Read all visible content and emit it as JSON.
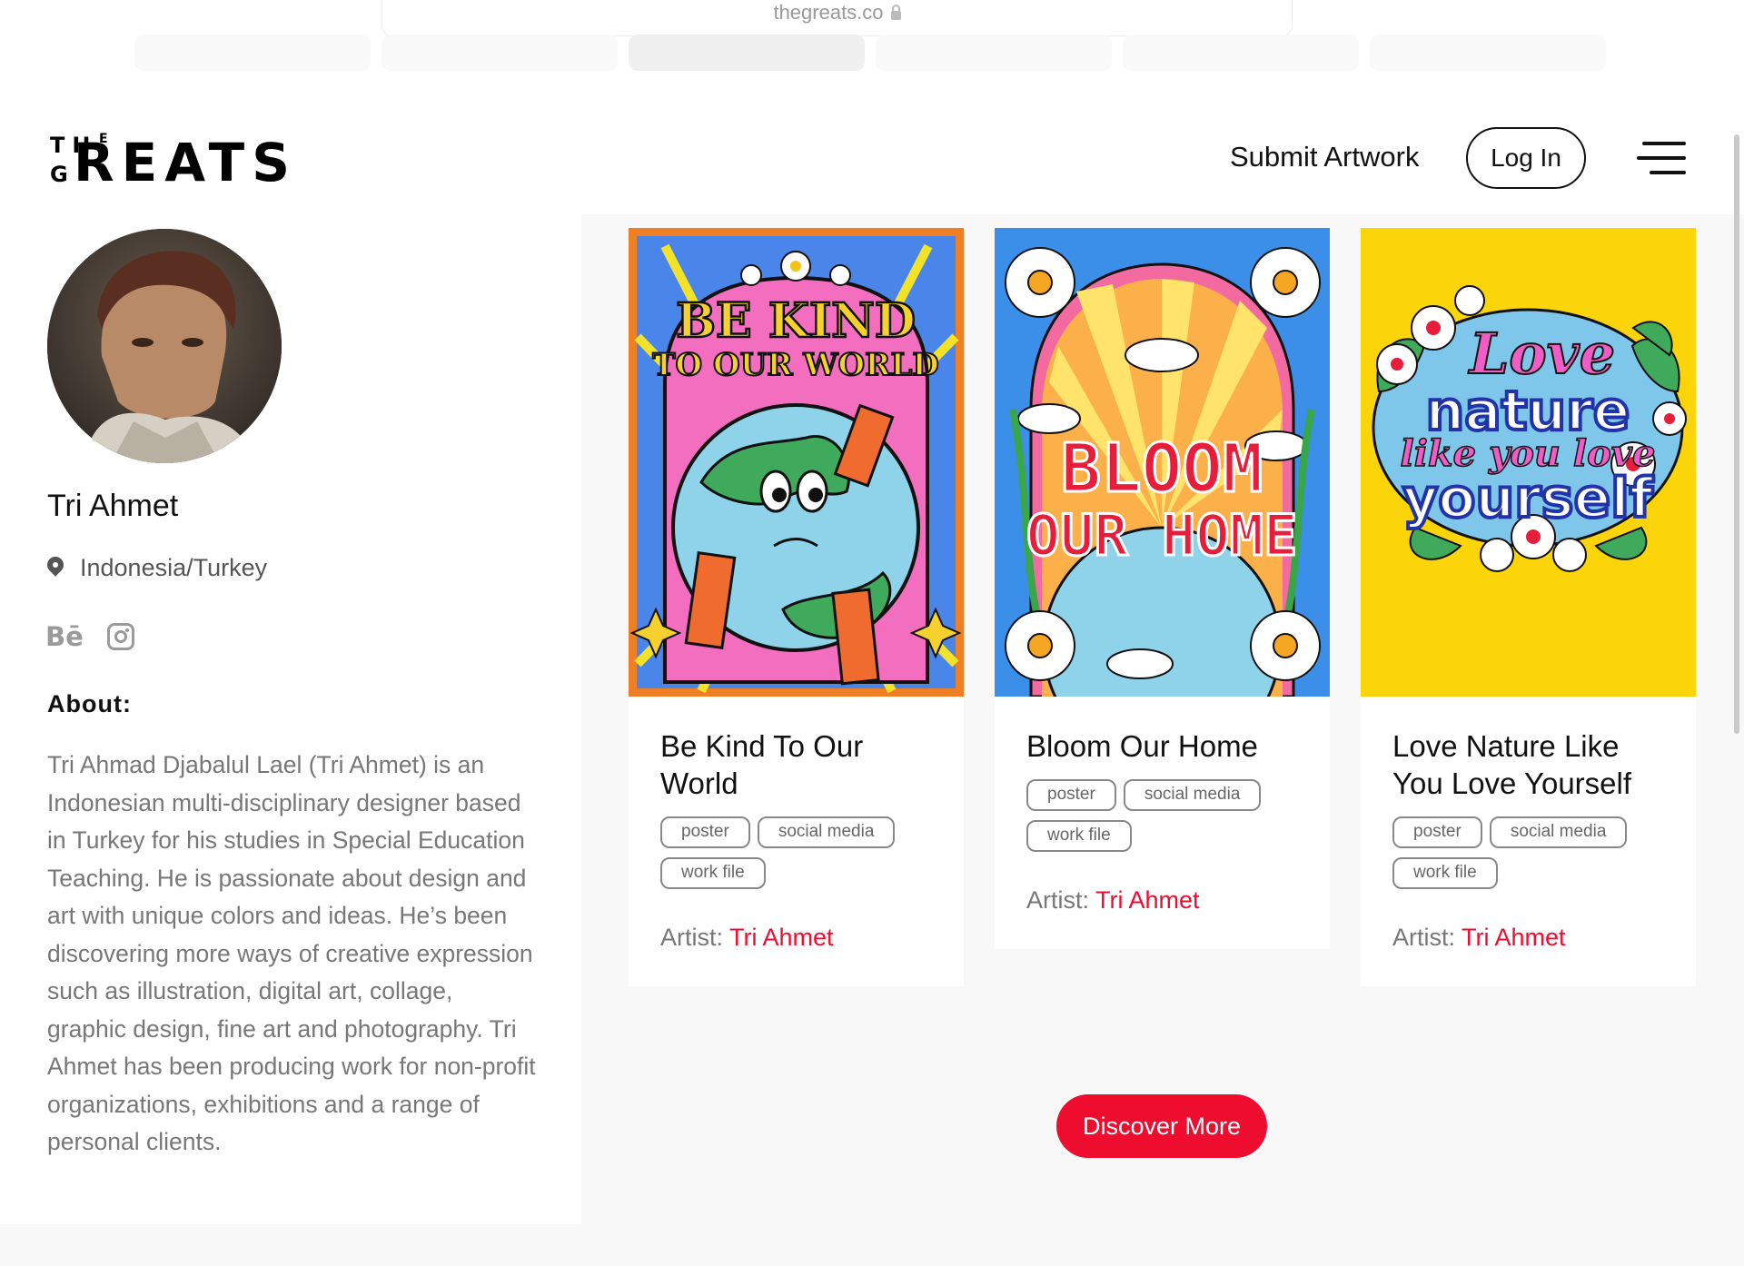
{
  "browser": {
    "host": "thegreats.co"
  },
  "header": {
    "logo": {
      "the": "THE",
      "e": "E",
      "g": "G",
      "reats": "REATS"
    },
    "submit_label": "Submit Artwork",
    "login_label": "Log In"
  },
  "profile": {
    "name": "Tri Ahmet",
    "location": "Indonesia/Turkey",
    "behance_label": "Bē",
    "about_label": "About:",
    "about_text": "Tri Ahmad Djabalul Lael (Tri Ahmet) is an Indonesian multi-disciplinary designer based in Turkey for his studies in Special Education Teaching. He is passionate about design and art with unique colors and ideas. He’s been discovering more ways of creative expression such as illustration, digital art, collage, graphic design, fine art and photography. Tri Ahmet has been producing work for non-profit organizations, exhibitions and a range of personal clients."
  },
  "cards": [
    {
      "title": "Be Kind To Our World",
      "tags": [
        "poster",
        "social media",
        "work file"
      ],
      "artist_prefix": "Artist: ",
      "artist": "Tri Ahmet",
      "art": {
        "line1": "BE KIND",
        "line2": "TO OUR WORLD",
        "border_color": "#ef7f24",
        "bg_color": "#4a86ea"
      }
    },
    {
      "title": "Bloom Our Home",
      "tags": [
        "poster",
        "social media",
        "work file"
      ],
      "artist_prefix": "Artist: ",
      "artist": "Tri Ahmet",
      "art": {
        "line1": "BLOOM",
        "line2": "OUR HOME",
        "bg_color": "#3b8fe9"
      }
    },
    {
      "title": "Love Nature Like You Love Yourself",
      "tags": [
        "poster",
        "social media",
        "work file"
      ],
      "artist_prefix": "Artist: ",
      "artist": "Tri Ahmet",
      "art": {
        "line1": "Love",
        "line2": "nature",
        "line3": "like you love",
        "line4": "yourself",
        "bg_color": "#fbd40a"
      }
    }
  ],
  "discover_label": "Discover More",
  "colors": {
    "accent": "#ee0d2f",
    "text": "#111111",
    "muted": "#777777"
  }
}
